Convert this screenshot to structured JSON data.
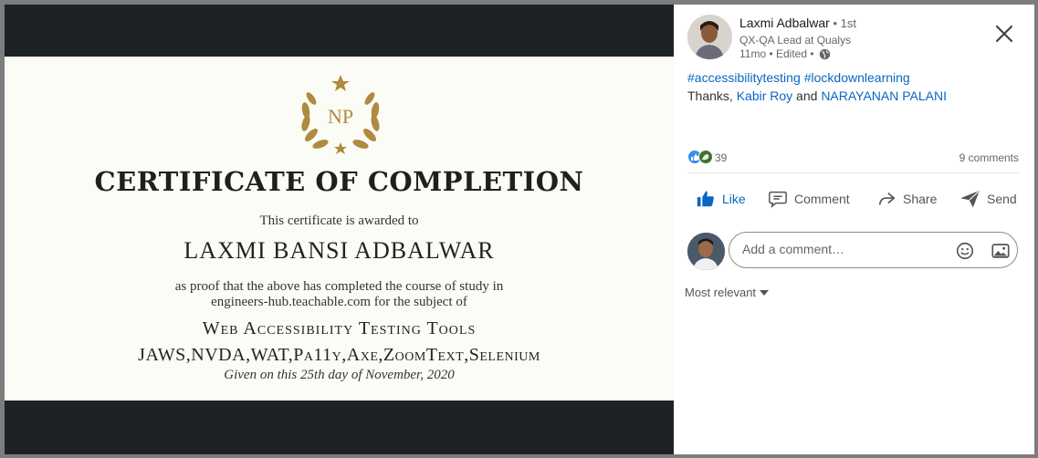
{
  "certificate": {
    "logo_text": "NP",
    "title": "CERTIFICATE OF COMPLETION",
    "awarded_text": "This certificate is awarded to",
    "recipient": "LAXMI BANSI ADBALWAR",
    "proof_line1": "as proof that the above has completed the course of study in",
    "proof_line2": "engineers-hub.teachable.com for the subject of",
    "course": "Web Accessibility Testing Tools",
    "tools": "JAWS,NVDA,WAT,Pa11y,Axe,ZoomText,Selenium",
    "given": "Given on this 25th day of November, 2020",
    "accent_color": "#b08a3e"
  },
  "post": {
    "author_name": "Laxmi Adbalwar",
    "connection": " • 1st",
    "author_title": "QX-QA Lead at Qualys",
    "time": "11mo • Edited •",
    "hashtags": [
      "#accessibilitytesting",
      "#lockdownlearning"
    ],
    "thanks_prefix": "Thanks, ",
    "mention1": "Kabir Roy",
    "and_text": " and ",
    "mention2": "NARAYANAN PALANI",
    "reactions_count": "39",
    "comments_count": "9 comments",
    "link_color": "#0a66c2"
  },
  "actions": {
    "like": "Like",
    "comment": "Comment",
    "share": "Share",
    "send": "Send"
  },
  "comment_input": {
    "placeholder": "Add a comment…"
  },
  "sort": {
    "label": "Most relevant"
  },
  "icons": [
    "globe-icon",
    "close-icon",
    "like-icon",
    "comment-icon",
    "share-icon",
    "send-icon",
    "emoji-icon",
    "image-icon",
    "chevron-down-icon",
    "laurel-wreath-icon"
  ]
}
